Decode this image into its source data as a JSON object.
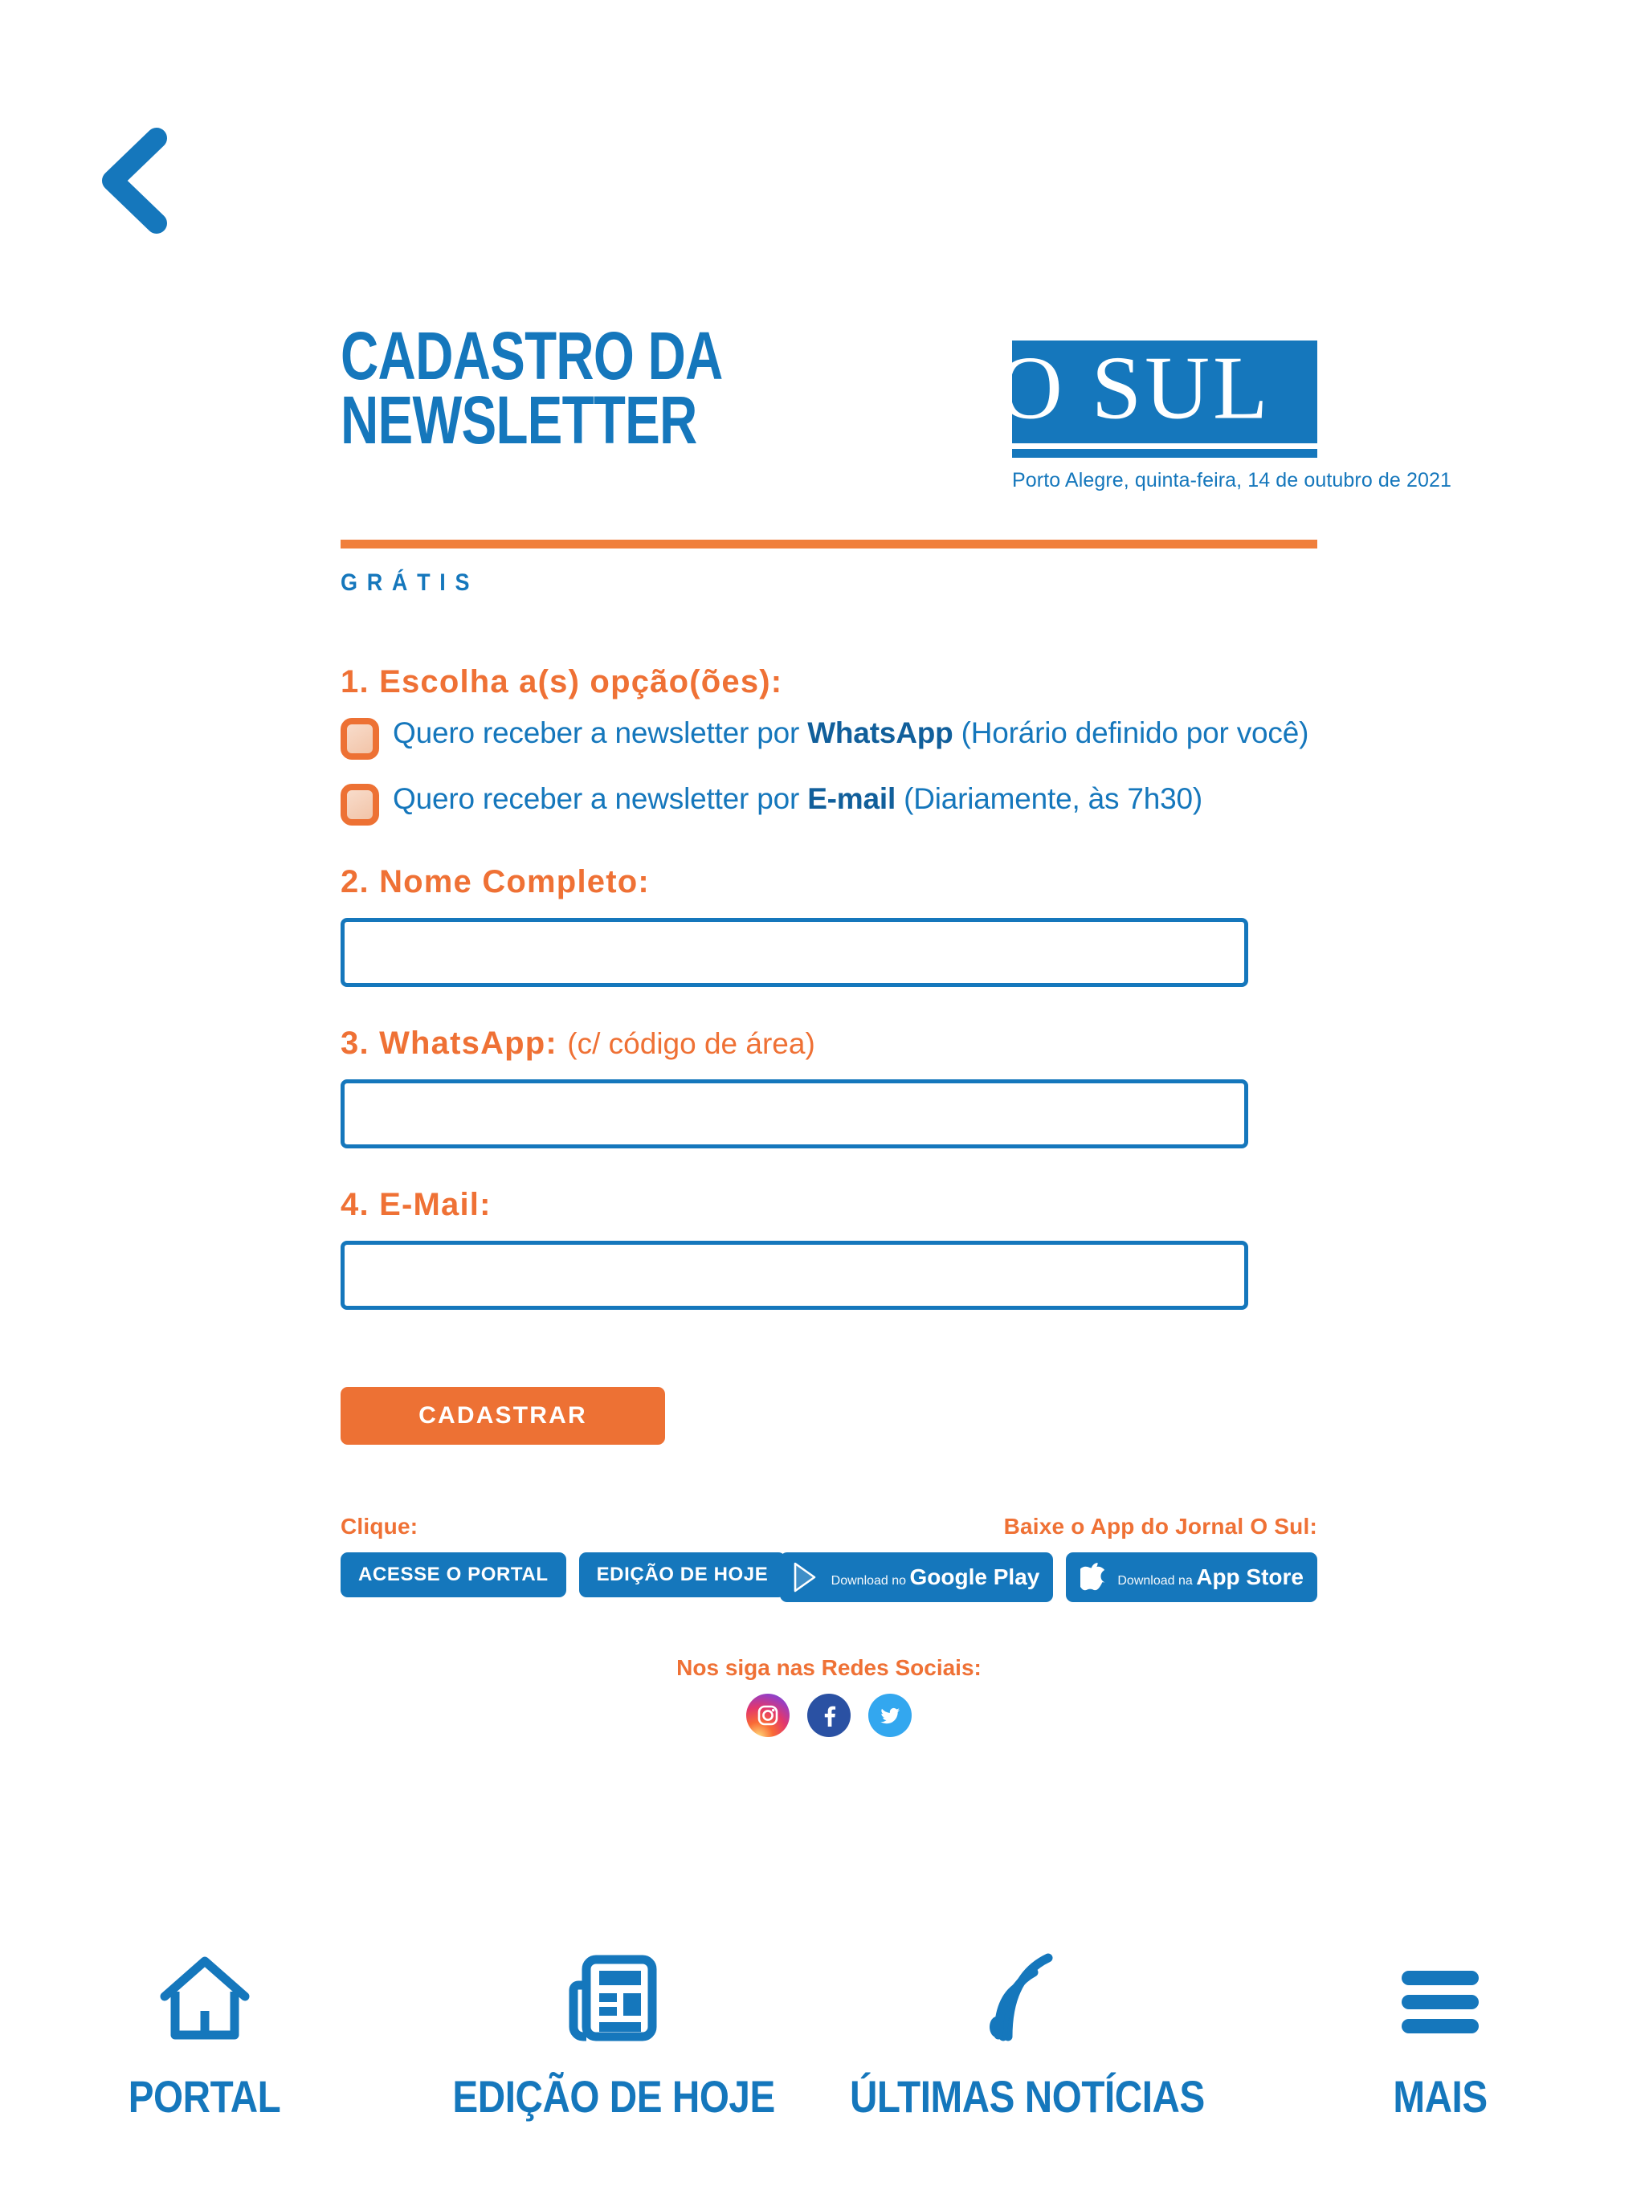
{
  "nav_back": {
    "icon": "chevron-left-icon"
  },
  "header": {
    "title": "CADASTRO DA\nNEWSLETTER",
    "free_label": "GRÁTIS",
    "logo_text": "O SUL",
    "dateline": "Porto Alegre, quinta-feira, 14 de outubro de 2021"
  },
  "form": {
    "step1": {
      "label": "1. Escolha a(s) opção(ões):",
      "options": [
        {
          "prefix": "Quero receber a newsletter por ",
          "strong": "WhatsApp",
          "suffix": " (Horário definido por você)",
          "checked": false
        },
        {
          "prefix": "Quero receber a newsletter por ",
          "strong": "E-mail",
          "suffix": " (Diariamente, às 7h30)",
          "checked": false
        }
      ]
    },
    "step2": {
      "label": "2. Nome Completo:",
      "value": "",
      "placeholder": ""
    },
    "step3": {
      "label": "3. WhatsApp:",
      "hint": "(c/ código de área)",
      "value": "",
      "placeholder": ""
    },
    "step4": {
      "label": "4. E-Mail:",
      "value": "",
      "placeholder": ""
    },
    "submit_label": "CADASTRAR"
  },
  "footer": {
    "clique_heading": "Clique:",
    "clique_buttons": [
      {
        "label": "ACESSE O PORTAL"
      },
      {
        "label": "EDIÇÃO DE HOJE"
      }
    ],
    "apps_heading": "Baixe o App do Jornal O Sul:",
    "store_badges": [
      {
        "icon": "google-play-icon",
        "small": "Download no",
        "big": "Google Play"
      },
      {
        "icon": "apple-icon",
        "small": "Download na",
        "big": "App Store"
      }
    ],
    "social_heading": "Nos siga nas Redes Sociais:",
    "social": [
      {
        "icon": "instagram-icon",
        "name": "Instagram"
      },
      {
        "icon": "facebook-icon",
        "name": "Facebook"
      },
      {
        "icon": "twitter-icon",
        "name": "Twitter"
      }
    ]
  },
  "bottom_nav": [
    {
      "icon": "home-icon",
      "label": "PORTAL"
    },
    {
      "icon": "newspaper-icon",
      "label": "EDIÇÃO DE HOJE"
    },
    {
      "icon": "rss-icon",
      "label": "ÚLTIMAS NOTÍCIAS"
    },
    {
      "icon": "hamburger-icon",
      "label": "MAIS"
    }
  ],
  "colors": {
    "blue": "#1577BC",
    "orange": "#EF7135",
    "orange_rule": "#F07F3C",
    "white": "#FFFFFF"
  }
}
